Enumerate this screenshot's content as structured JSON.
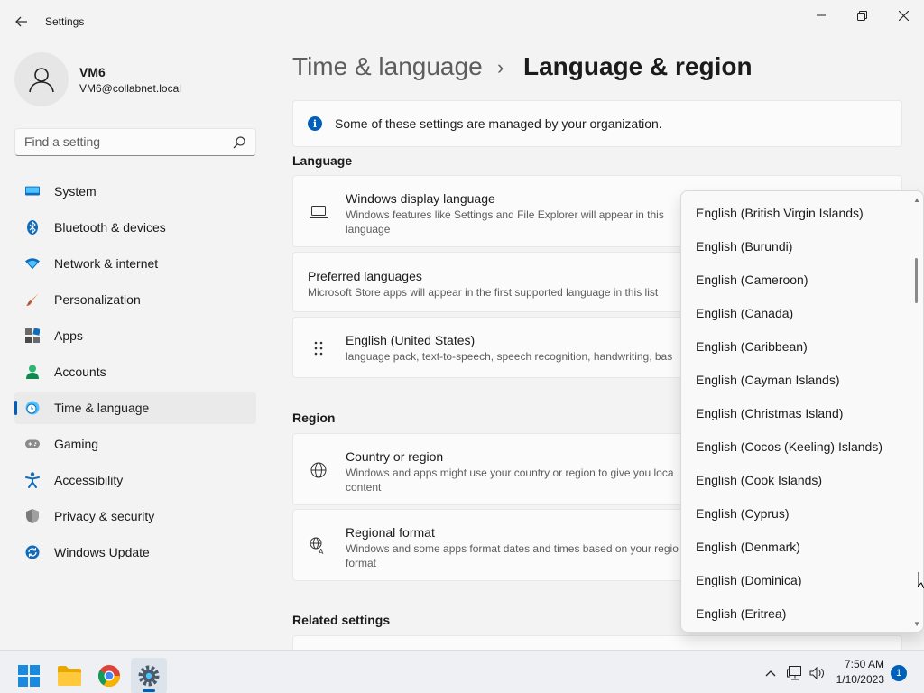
{
  "window": {
    "title": "Settings",
    "back_glyph": "←",
    "min_glyph": "—",
    "max_glyph": "❐",
    "close_glyph": "✕"
  },
  "profile": {
    "name": "VM6",
    "email": "VM6@collabnet.local"
  },
  "search": {
    "placeholder": "Find a setting"
  },
  "nav": {
    "items": [
      {
        "label": "System",
        "icon": "system-icon"
      },
      {
        "label": "Bluetooth & devices",
        "icon": "bluetooth-icon"
      },
      {
        "label": "Network & internet",
        "icon": "wifi-icon"
      },
      {
        "label": "Personalization",
        "icon": "brush-icon"
      },
      {
        "label": "Apps",
        "icon": "apps-icon"
      },
      {
        "label": "Accounts",
        "icon": "accounts-icon"
      },
      {
        "label": "Time & language",
        "icon": "time-language-icon",
        "active": true
      },
      {
        "label": "Gaming",
        "icon": "gamepad-icon"
      },
      {
        "label": "Accessibility",
        "icon": "accessibility-icon"
      },
      {
        "label": "Privacy & security",
        "icon": "shield-icon"
      },
      {
        "label": "Windows Update",
        "icon": "update-icon"
      }
    ]
  },
  "breadcrumb": {
    "parent": "Time & language",
    "separator": "›",
    "current": "Language & region"
  },
  "info": {
    "text": "Some of these settings are managed by your organization."
  },
  "language": {
    "heading": "Language",
    "display": {
      "title": "Windows display language",
      "desc": "Windows features like Settings and File Explorer will appear in this language"
    },
    "preferred": {
      "title": "Preferred languages",
      "desc": "Microsoft Store apps will appear in the first supported language in this list"
    },
    "english_us": {
      "title": "English (United States)",
      "desc": "language pack, text-to-speech, speech recognition, handwriting, bas"
    }
  },
  "region": {
    "heading": "Region",
    "country": {
      "title": "Country or region",
      "desc": "Windows and apps might use your country or region to give you loca content"
    },
    "format": {
      "title": "Regional format",
      "desc": "Windows and some apps format dates and times based on your regio format"
    }
  },
  "related": {
    "heading": "Related settings"
  },
  "dropdown": {
    "options": [
      "English (British Virgin Islands)",
      "English (Burundi)",
      "English (Cameroon)",
      "English (Canada)",
      "English (Caribbean)",
      "English (Cayman Islands)",
      "English (Christmas Island)",
      "English (Cocos (Keeling) Islands)",
      "English (Cook Islands)",
      "English (Cyprus)",
      "English (Denmark)",
      "English (Dominica)",
      "English (Eritrea)"
    ]
  },
  "taskbar": {
    "time": "7:50 AM",
    "date": "1/10/2023",
    "notifications": "1",
    "apps": [
      "start-icon",
      "file-explorer-icon",
      "chrome-icon",
      "settings-icon"
    ]
  },
  "colors": {
    "accent": "#005fb8",
    "background": "#f3f3f3",
    "card": "#fbfbfb"
  }
}
